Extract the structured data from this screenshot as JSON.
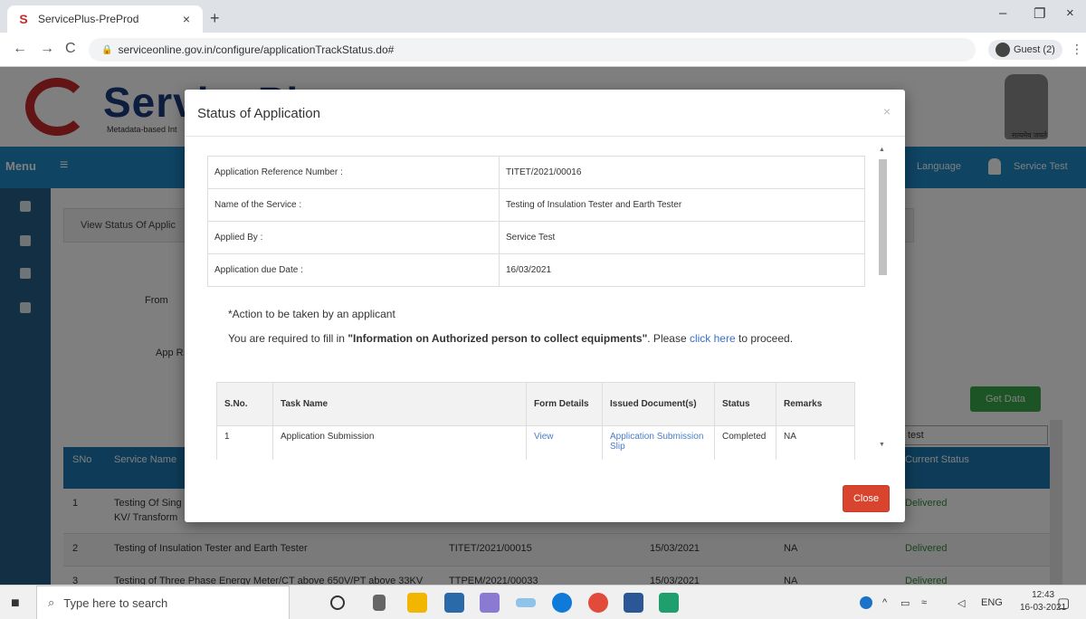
{
  "browser": {
    "tab_title": "ServicePlus-PreProd",
    "tab_close": "×",
    "new_tab": "+",
    "url": "serviceonline.gov.in/configure/applicationTrackStatus.do#",
    "profile": "Guest (2)",
    "back": "←",
    "forward": "→",
    "reload": "C",
    "menu": "⋮",
    "minimize": "–",
    "restore": "❐",
    "close": "×"
  },
  "page": {
    "logo_text": "ServicePlus",
    "logo_tagline": "Metadata-based Int",
    "emblem_text": "सत्यमेव जयते",
    "menu_label": "Menu",
    "burger": "≡",
    "language": "Language",
    "user": "Service Test",
    "breadcrumb": "View Status Of Applic",
    "from_label": "From",
    "app_ref_label": "App R",
    "get_data": "Get Data",
    "search_value": "test",
    "table_headers": [
      "SNo",
      "Service Name",
      "Current Status"
    ],
    "rows": [
      {
        "sno": "1",
        "service": "Testing Of Sing",
        "service2": "KV/ Transform",
        "ref": "",
        "date": "",
        "remarks": "",
        "status": "Delivered"
      },
      {
        "sno": "2",
        "service": "Testing of Insulation Tester and Earth Tester",
        "service2": "",
        "ref": "TITET/2021/00015",
        "date": "15/03/2021",
        "remarks": "NA",
        "status": "Delivered"
      },
      {
        "sno": "3",
        "service": "Testing of Three Phase Energy Meter/CT above 650V/PT above 33KV",
        "service2": "",
        "ref": "TTPEM/2021/00033",
        "date": "15/03/2021",
        "remarks": "NA",
        "status": "Delivered"
      }
    ]
  },
  "modal": {
    "title": "Status of Application",
    "close_x": "×",
    "info": [
      {
        "label": "Application Reference Number :",
        "value": "TITET/2021/00016"
      },
      {
        "label": "Name of the Service :",
        "value": "Testing of Insulation Tester and Earth Tester"
      },
      {
        "label": "Applied By :",
        "value": "Service Test"
      },
      {
        "label": "Application due Date :",
        "value": "16/03/2021"
      }
    ],
    "action_heading": "*Action to be taken by an applicant",
    "action_prefix": "You are required to fill in ",
    "action_bold": "\"Information on Authorized person to collect equipments\"",
    "action_middle": ". Please ",
    "action_link": "click here",
    "action_suffix": " to proceed.",
    "task_headers": [
      "S.No.",
      "Task Name",
      "Form Details",
      "Issued Document(s)",
      "Status",
      "Remarks"
    ],
    "tasks": [
      {
        "sno": "1",
        "name": "Application Submission",
        "form": "View",
        "doc": "Application Submission Slip",
        "status": "Completed",
        "remarks": "NA"
      }
    ],
    "close_button": "Close"
  },
  "taskbar": {
    "search_placeholder": "Type here to search",
    "tray_lang": "ENG",
    "time": "12:43",
    "date": "16-03-2021"
  },
  "colors": {
    "menubar": "#1e88c6",
    "sidebar": "#245e86",
    "close_button": "#d9442f",
    "link": "#4a7ec8",
    "get_data": "#3aa84b"
  }
}
